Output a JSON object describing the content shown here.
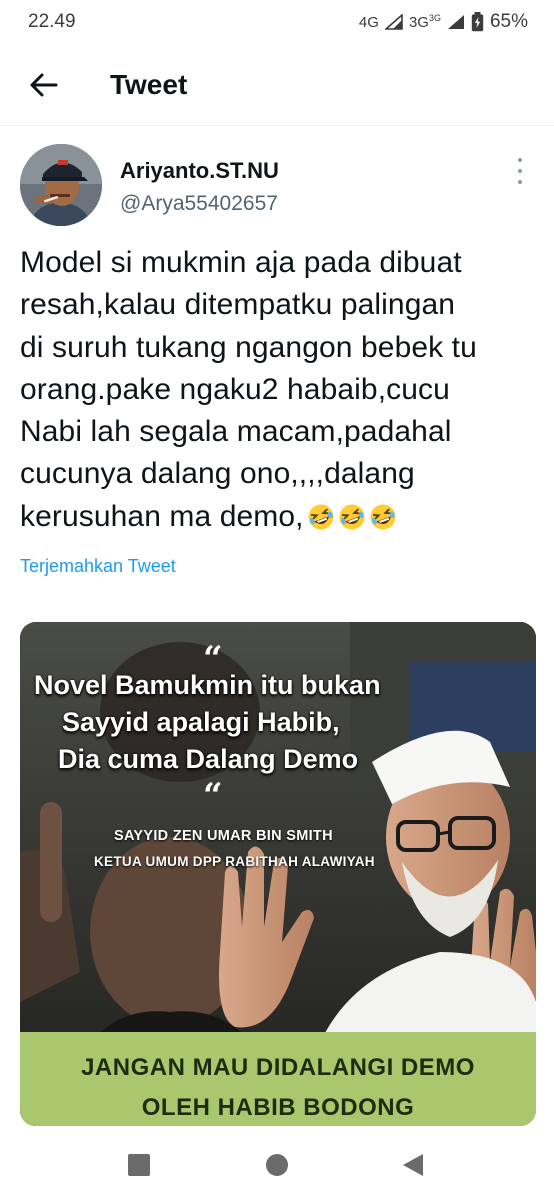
{
  "status_bar": {
    "time": "22.49",
    "network_1": "4G",
    "network_2": "3G",
    "network_2_sup": "3G",
    "battery": "65%"
  },
  "header": {
    "title": "Tweet",
    "back_icon": "arrow-left-icon"
  },
  "tweet": {
    "author": {
      "display_name": "Ariyanto.ST.NU",
      "handle": "@Arya55402657"
    },
    "text_lines": [
      "Model si mukmin aja pada dibuat",
      "resah,kalau ditempatku palingan",
      "di suruh tukang ngangon bebek tu",
      "orang.pake ngaku2 habaib,cucu",
      "Nabi lah segala macam,padahal",
      "cucunya dalang ono,,,,dalang",
      "kerusuhan ma demo,"
    ],
    "emojis": [
      "rofl-emoji",
      "rofl-emoji",
      "rofl-emoji"
    ],
    "translate_label": "Terjemahkan Tweet",
    "media": {
      "quote_open": "“",
      "quote_close": "“",
      "quote_lines": [
        "Novel Bamukmin itu bukan",
        "Sayyid apalagi Habib,",
        "Dia cuma Dalang Demo"
      ],
      "attribution_name": "SAYYID ZEN UMAR BIN SMITH",
      "attribution_title": "KETUA UMUM DPP RABITHAH ALAWIYAH",
      "banner_lines": [
        "JANGAN MAU DIDALANGI DEMO",
        "OLEH HABIB BODONG"
      ],
      "banner_color": "#a9c86e"
    }
  },
  "nav": {
    "items": [
      "recents-square-icon",
      "home-circle-icon",
      "back-triangle-icon"
    ]
  },
  "colors": {
    "link": "#1d9bf0",
    "secondary_text": "#536471",
    "primary_text": "#0f1419"
  }
}
